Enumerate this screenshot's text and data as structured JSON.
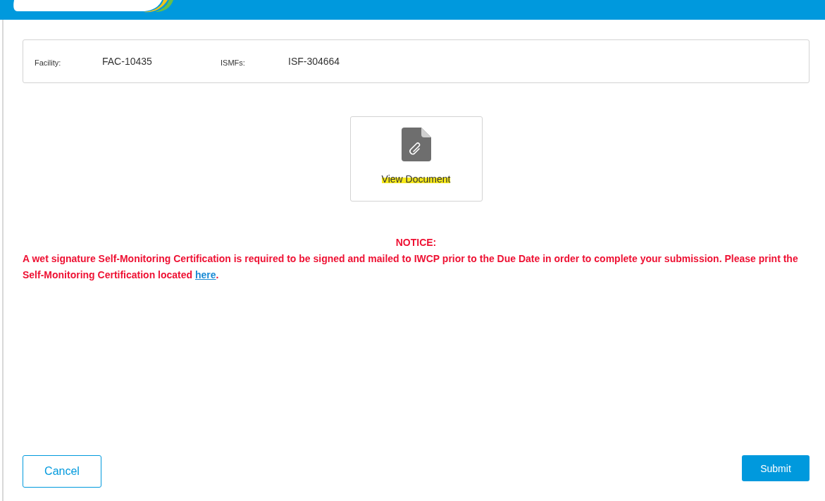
{
  "info": [
    {
      "label": "Facility:",
      "value": "FAC-10435"
    },
    {
      "label": "ISMFs:",
      "value": "ISF-304664"
    }
  ],
  "document": {
    "label": "View Document",
    "highlighted": true
  },
  "notice": {
    "title": "NOTICE:",
    "text": "A wet signature Self-Monitoring Certification is required to be signed and mailed to IWCP prior to the Due Date in order to complete your submission. Please print the Self-Monitoring Certification located ",
    "link": "here",
    "end": "."
  },
  "buttons": {
    "cancel": "Cancel",
    "submit": "Submit"
  }
}
